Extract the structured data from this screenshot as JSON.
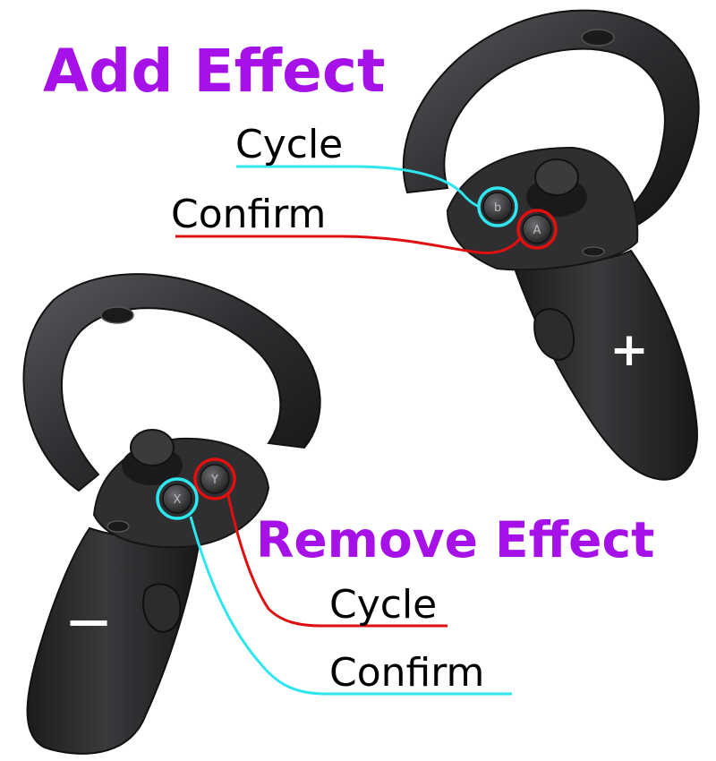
{
  "add_section": {
    "title": "Add Effect",
    "cycle_label": "Cycle",
    "confirm_label": "Confirm",
    "plus_symbol": "+"
  },
  "remove_section": {
    "title": "Remove Effect",
    "cycle_label": "Cycle",
    "confirm_label": "Confirm",
    "minus_symbol": "—"
  },
  "colors": {
    "title": "#a611e8",
    "cycle_line_add": "#2ee6ee",
    "confirm_line_add": "#e01010",
    "cycle_line_remove": "#e01010",
    "confirm_line_remove": "#2ee6ee",
    "controller_body": "#2b2b2d",
    "controller_shade": "#1a1a1b",
    "label_text": "#000000"
  },
  "icons": {
    "add_controller": "vr-controller-right-icon",
    "remove_controller": "vr-controller-left-icon"
  }
}
